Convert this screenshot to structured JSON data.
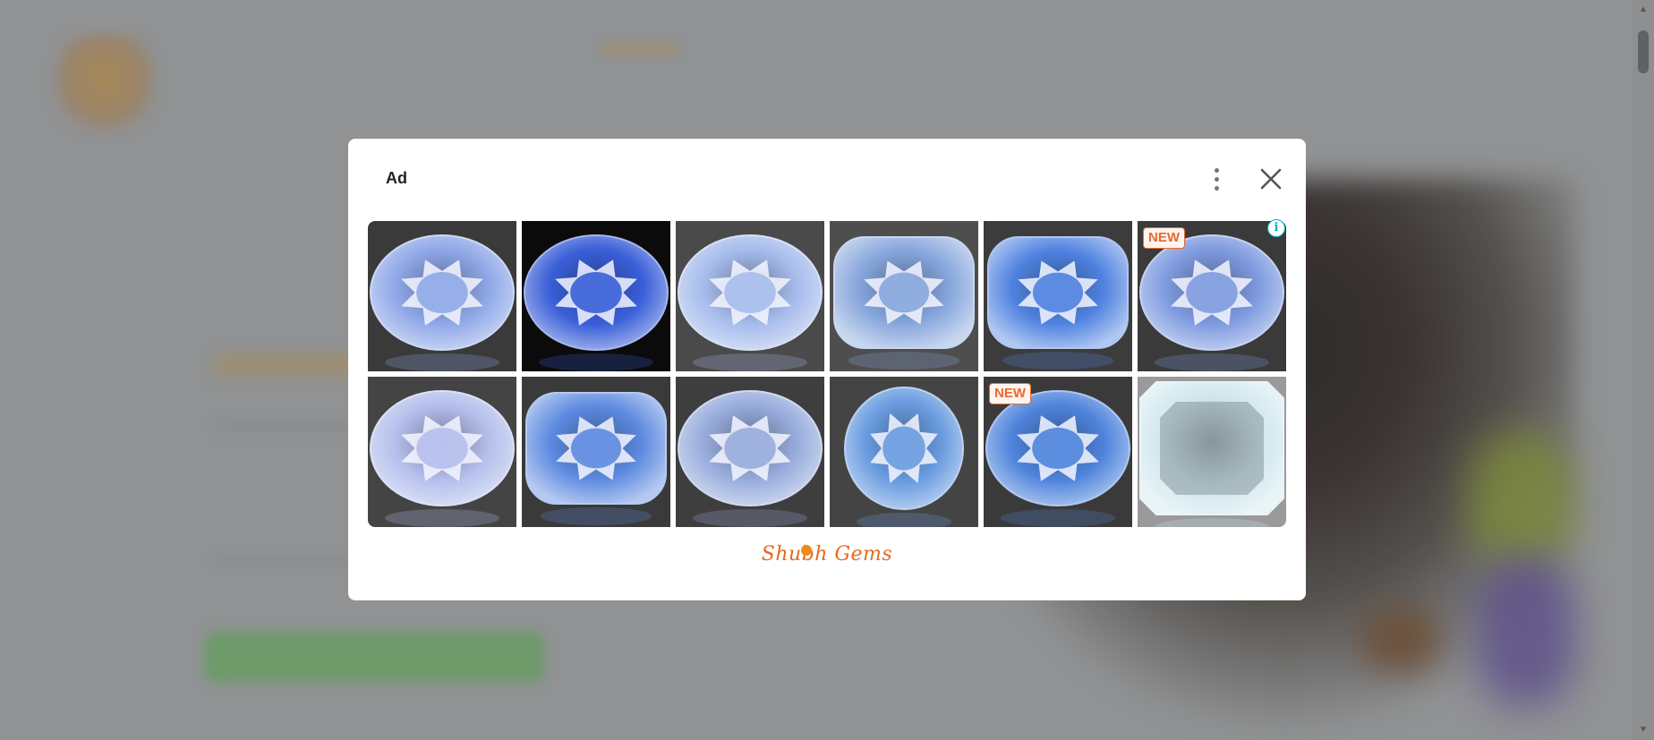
{
  "modal": {
    "ad_label": "Ad",
    "brand_name": "Shubh Gems",
    "menu_icon": "more-vert-icon",
    "close_icon": "close-icon",
    "info_icon": "i",
    "badge_text": "NEW"
  },
  "gems": [
    {
      "shape": "oval",
      "background": "#3a3a3a",
      "color": "#8fa8e8",
      "badge": null
    },
    {
      "shape": "oval",
      "background": "#0b0b0b",
      "color": "#3a5fd8",
      "badge": null
    },
    {
      "shape": "oval",
      "background": "#4a4a4a",
      "color": "#a6bcec",
      "badge": null
    },
    {
      "shape": "cushion",
      "background": "#4e4e4e",
      "color": "#86a6dc",
      "badge": null
    },
    {
      "shape": "cushion",
      "background": "#3c3c3c",
      "color": "#4f82e0",
      "badge": null
    },
    {
      "shape": "oval",
      "background": "#3a3a3a",
      "color": "#7f9be0",
      "badge": "NEW"
    },
    {
      "shape": "oval",
      "background": "#444444",
      "color": "#b4bfec",
      "badge": null
    },
    {
      "shape": "cushion",
      "background": "#3a3a3a",
      "color": "#5d8ae0",
      "badge": null
    },
    {
      "shape": "oval",
      "background": "#3e3e3e",
      "color": "#98acdc",
      "badge": null
    },
    {
      "shape": "round",
      "background": "#444444",
      "color": "#6a9ce0",
      "badge": null
    },
    {
      "shape": "oval",
      "background": "#3a3a3a",
      "color": "#4f84dc",
      "badge": "NEW"
    },
    {
      "shape": "octagon",
      "background": "#9a9a9a",
      "color": "#cfe6ee",
      "badge": null
    }
  ]
}
